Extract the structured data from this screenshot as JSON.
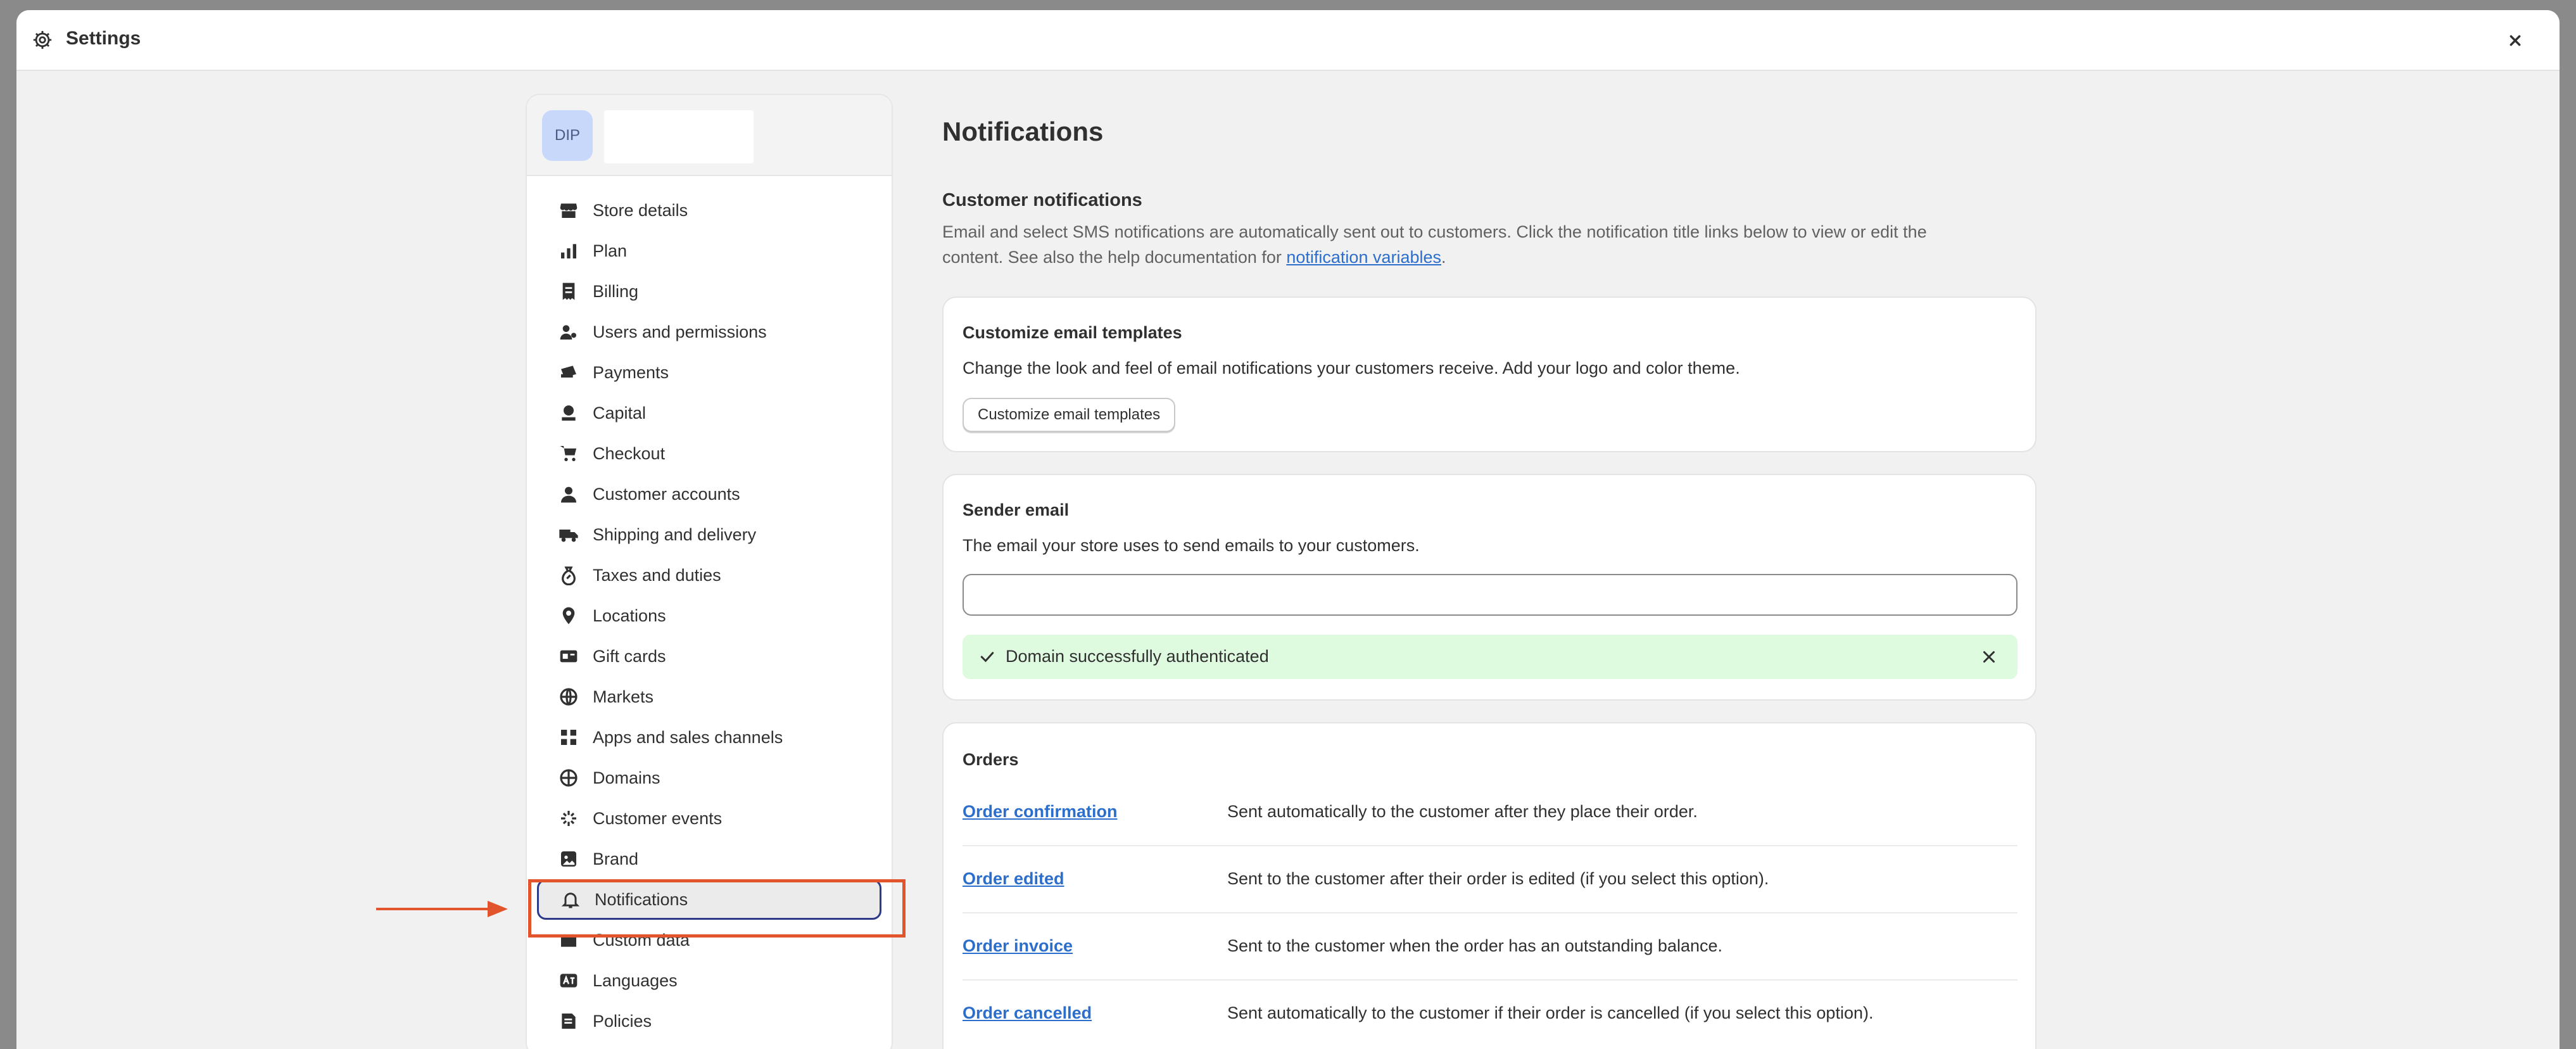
{
  "window": {
    "title": "Settings"
  },
  "store": {
    "avatar_initials": "DIP"
  },
  "sidebar": {
    "items": [
      {
        "label": "Store details",
        "icon": "store-icon"
      },
      {
        "label": "Plan",
        "icon": "plan-icon"
      },
      {
        "label": "Billing",
        "icon": "billing-icon"
      },
      {
        "label": "Users and permissions",
        "icon": "users-icon"
      },
      {
        "label": "Payments",
        "icon": "payments-icon"
      },
      {
        "label": "Capital",
        "icon": "capital-icon"
      },
      {
        "label": "Checkout",
        "icon": "cart-icon"
      },
      {
        "label": "Customer accounts",
        "icon": "person-icon"
      },
      {
        "label": "Shipping and delivery",
        "icon": "truck-icon"
      },
      {
        "label": "Taxes and duties",
        "icon": "tax-icon"
      },
      {
        "label": "Locations",
        "icon": "location-pin-icon"
      },
      {
        "label": "Gift cards",
        "icon": "gift-card-icon"
      },
      {
        "label": "Markets",
        "icon": "globe-icon"
      },
      {
        "label": "Apps and sales channels",
        "icon": "apps-icon"
      },
      {
        "label": "Domains",
        "icon": "domain-globe-icon"
      },
      {
        "label": "Customer events",
        "icon": "events-icon"
      },
      {
        "label": "Brand",
        "icon": "brand-icon"
      },
      {
        "label": "Notifications",
        "icon": "bell-icon"
      },
      {
        "label": "Custom data",
        "icon": "custom-data-icon"
      },
      {
        "label": "Languages",
        "icon": "languages-icon"
      },
      {
        "label": "Policies",
        "icon": "policies-icon"
      }
    ],
    "active_label": "Notifications"
  },
  "main": {
    "page_title": "Notifications",
    "customer_notifications": {
      "title": "Customer notifications",
      "desc_line1": "Email and select SMS notifications are automatically sent out to customers. Click the notification title links below to view or edit the",
      "desc_line2_prefix": "content. See also the help documentation for ",
      "desc_link": "notification variables",
      "desc_suffix": "."
    },
    "customize_card": {
      "title": "Customize email templates",
      "text": "Change the look and feel of email notifications your customers receive. Add your logo and color theme.",
      "button": "Customize email templates"
    },
    "sender_card": {
      "title": "Sender email",
      "text": "The email your store uses to send emails to your customers.",
      "input_value": "",
      "banner": "Domain successfully authenticated"
    },
    "orders_card": {
      "title": "Orders",
      "rows": [
        {
          "name": "Order confirmation",
          "desc": "Sent automatically to the customer after they place their order."
        },
        {
          "name": "Order edited",
          "desc": "Sent to the customer after their order is edited (if you select this option)."
        },
        {
          "name": "Order invoice",
          "desc": "Sent to the customer when the order has an outstanding balance."
        },
        {
          "name": "Order cancelled",
          "desc": "Sent automatically to the customer if their order is cancelled (if you select this option)."
        }
      ]
    }
  },
  "colors": {
    "accent": "#2c6ecb",
    "active_border": "#2b3b8a",
    "annotation": "#e2542c",
    "success_bg": "#defadf"
  }
}
